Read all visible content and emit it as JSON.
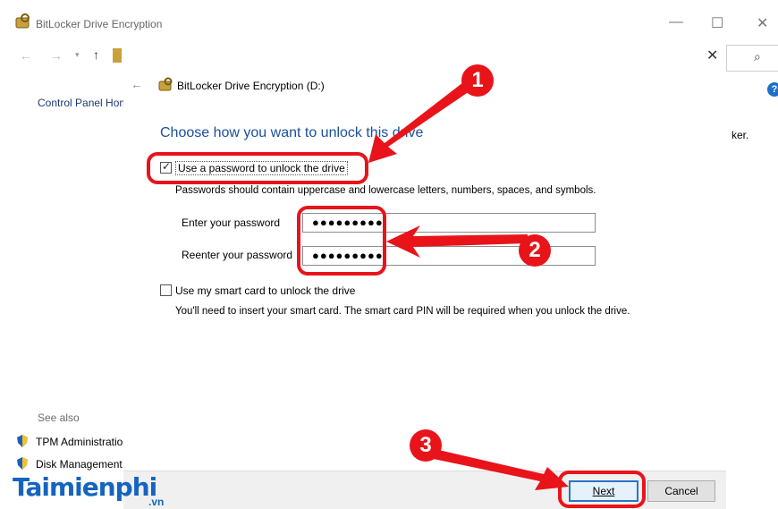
{
  "outer_window": {
    "title": "BitLocker Drive Encryption",
    "controls": {
      "minimize": "—",
      "maximize": "☐",
      "close": "✕"
    },
    "sidebar": {
      "home_link": "Control Panel Home",
      "see_also_label": "See also",
      "items": [
        {
          "label": "TPM Administration"
        },
        {
          "label": "Disk Management"
        }
      ]
    },
    "right_close": "✕",
    "search_glyph": "⌕",
    "help_glyph": "?",
    "right_text": "ker."
  },
  "dialog": {
    "back_glyph": "←",
    "title": "BitLocker Drive Encryption (D:)",
    "heading": "Choose how you want to unlock this drive",
    "password_option": {
      "label": "Use a password to unlock the drive",
      "checked": true,
      "note": "Passwords should contain uppercase and lowercase letters, numbers, spaces, and symbols."
    },
    "enter_password": {
      "label": "Enter your password",
      "value": "●●●●●●●●●"
    },
    "reenter_password": {
      "label": "Reenter your password",
      "value": "●●●●●●●●●"
    },
    "smartcard_option": {
      "label": "Use my smart card to unlock the drive",
      "checked": false,
      "note": "You'll need to insert your smart card. The smart card PIN will be required when you unlock the drive."
    },
    "buttons": {
      "next": "Next",
      "cancel": "Cancel"
    }
  },
  "annotations": {
    "badges": [
      "1",
      "2",
      "3"
    ],
    "color": "#e8141a"
  },
  "watermark": {
    "brand": "Taimienphi",
    "tld": ".vn"
  },
  "colors": {
    "heading": "#1b4f9c",
    "accent": "#2d74c9",
    "link": "#1e3a6e"
  }
}
